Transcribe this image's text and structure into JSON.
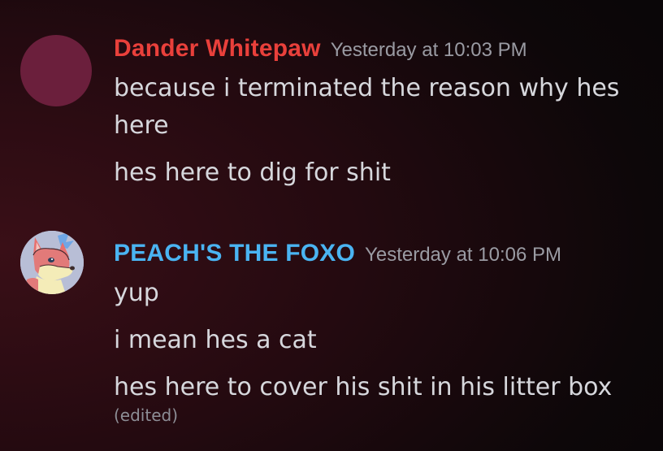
{
  "colors": {
    "dander_name": "#e9403b",
    "peach_name": "#4ab4f2",
    "message_text": "#d6d7dc",
    "timestamp": "#9a9ba3",
    "dander_avatar": "#6b1f3c"
  },
  "messages": [
    {
      "author": "Dander Whitepaw",
      "timestamp": "Yesterday at 10:03 PM",
      "avatar_icon": "plain-avatar",
      "lines": [
        "because i terminated the reason why hes here",
        "hes here to dig for shit"
      ]
    },
    {
      "author": "PEACH'S THE FOXO",
      "timestamp": "Yesterday at 10:06 PM",
      "avatar_icon": "fox-avatar",
      "lines": [
        "yup",
        "i mean hes a cat",
        "hes here to cover his shit in his litter box"
      ],
      "edited_label": "(edited)"
    }
  ]
}
